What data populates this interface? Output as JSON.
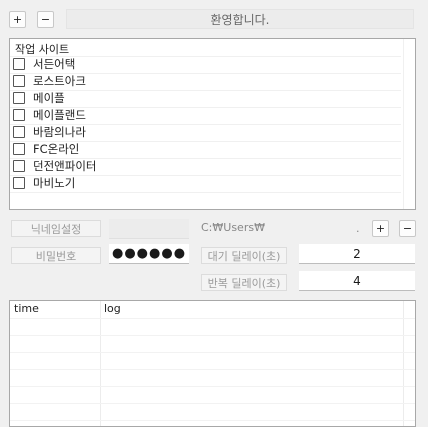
{
  "toolbar": {
    "add_label": "+",
    "remove_label": "−",
    "welcome_text": "환영합니다."
  },
  "sites": {
    "header": "작업 사이트",
    "items": [
      {
        "label": "서든어택",
        "checked": false
      },
      {
        "label": "로스트아크",
        "checked": false
      },
      {
        "label": "메이플",
        "checked": false
      },
      {
        "label": "메이플랜드",
        "checked": false
      },
      {
        "label": "바람의나라",
        "checked": false
      },
      {
        "label": "FC온라인",
        "checked": false
      },
      {
        "label": "던전앤파이터",
        "checked": false
      },
      {
        "label": "마비노기",
        "checked": false
      }
    ]
  },
  "form": {
    "nickname_label": "닉네임설정",
    "nickname_value": "",
    "path_text": "C:₩Users₩",
    "path_suffix": ".",
    "path_add_label": "+",
    "path_remove_label": "−",
    "password_label": "비밀번호",
    "password_value": "●●●●●●",
    "wait_delay_label": "대기 딜레이(초)",
    "wait_delay_value": "2",
    "repeat_delay_label": "반복 딜레이(초)",
    "repeat_delay_value": "4"
  },
  "log": {
    "columns": [
      "time",
      "log"
    ],
    "rows": []
  }
}
